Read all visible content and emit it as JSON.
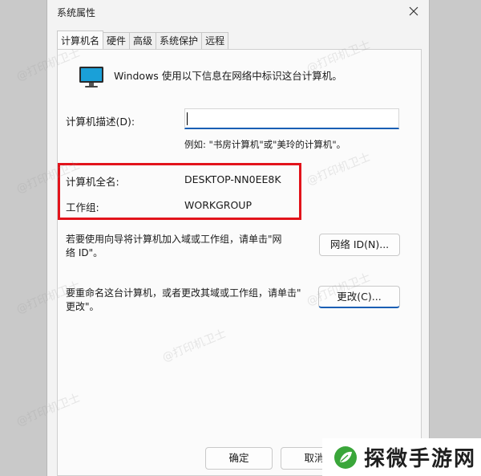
{
  "window": {
    "title": "系统属性"
  },
  "tabs": [
    {
      "label": "计算机名",
      "active": true
    },
    {
      "label": "硬件",
      "active": false
    },
    {
      "label": "高级",
      "active": false
    },
    {
      "label": "系统保护",
      "active": false
    },
    {
      "label": "远程",
      "active": false
    }
  ],
  "intro_text": "Windows 使用以下信息在网络中标识这台计算机。",
  "description": {
    "label": "计算机描述(D):",
    "value": "",
    "example": "例如: \"书房计算机\"或\"美玲的计算机\"。"
  },
  "full_name": {
    "label": "计算机全名:",
    "value": "DESKTOP-NN0EE8K"
  },
  "workgroup": {
    "label": "工作组:",
    "value": "WORKGROUP"
  },
  "network_id": {
    "text_line1": "若要使用向导将计算机加入域或工作组，请单击\"网",
    "text_line2": "络 ID\"。",
    "button_label": "网络 ID(N)..."
  },
  "rename": {
    "text_line1": "要重命名这台计算机，或者更改其域或工作组，请单击\"",
    "text_line2": "更改\"。",
    "button_label": "更改(C)..."
  },
  "footer": {
    "ok_label": "确定",
    "cancel_label": "取消"
  },
  "watermark_text": "@打印机卫士",
  "logo_text": "探微手游网",
  "colors": {
    "highlight": "#e2131b",
    "accent": "#1a5fb4",
    "logo_green": "#3aa63a"
  }
}
